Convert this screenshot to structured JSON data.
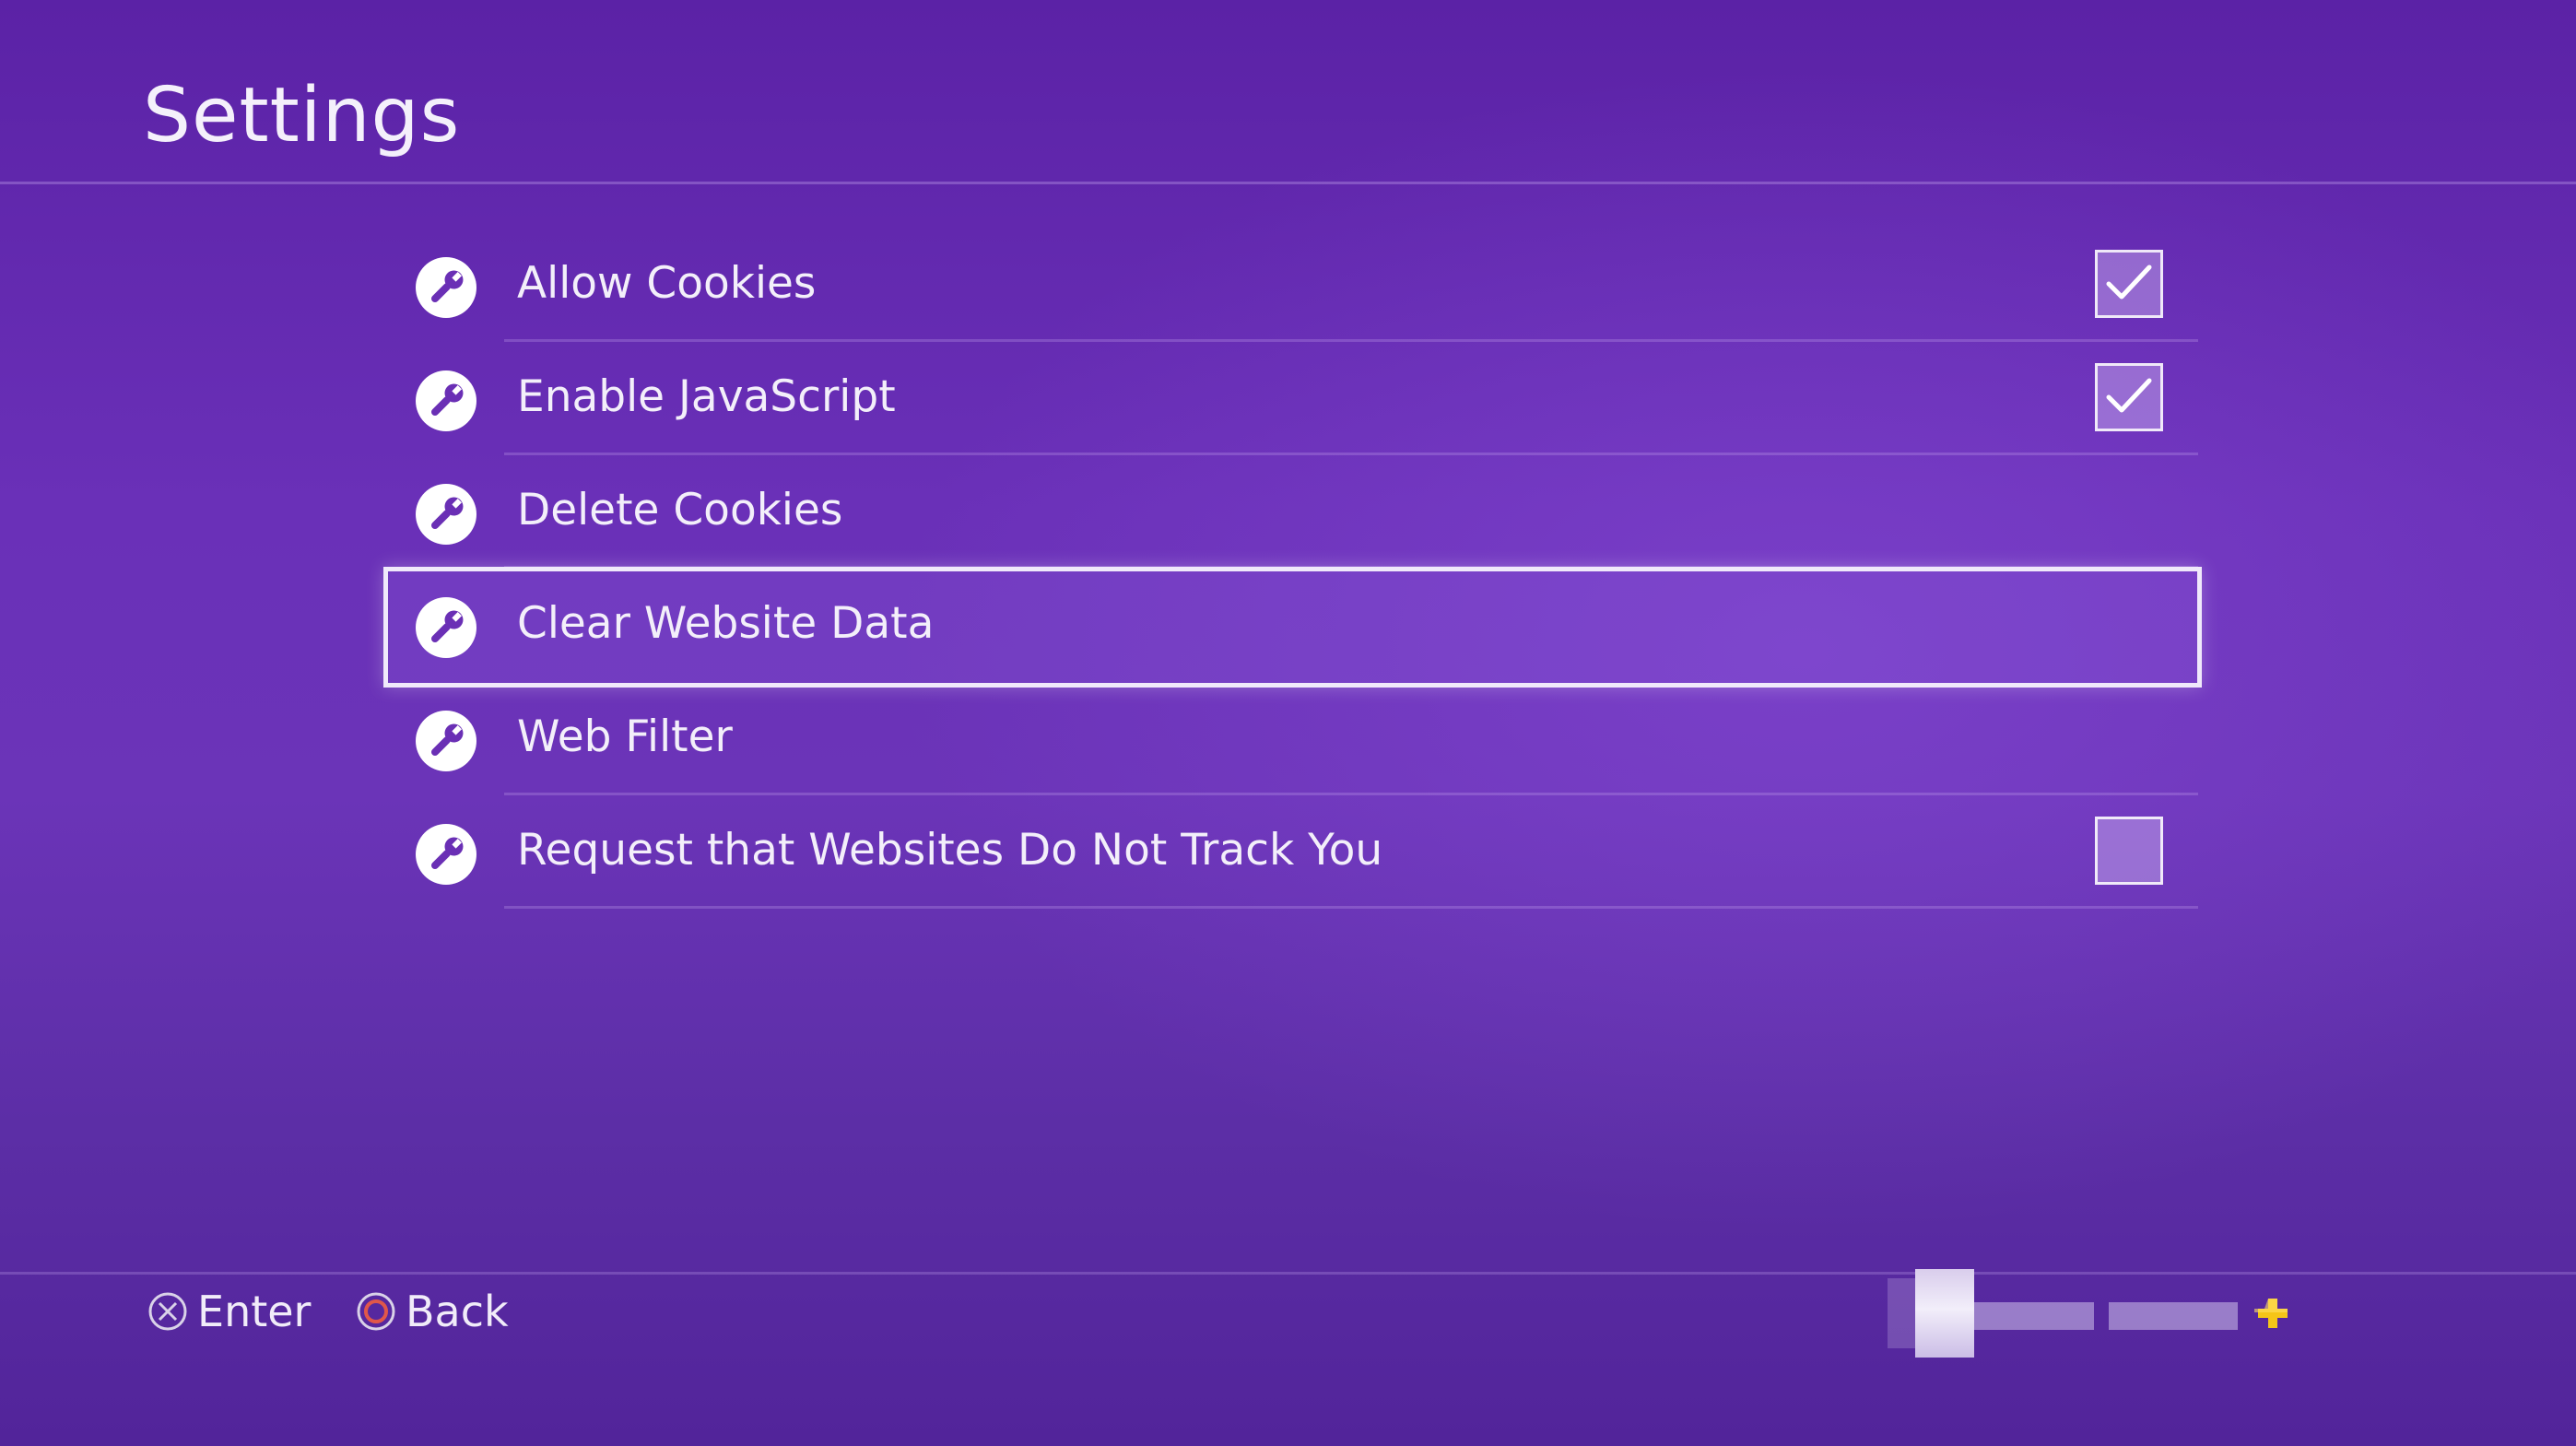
{
  "page": {
    "title": "Settings"
  },
  "menu": {
    "items": [
      {
        "label": "Allow Cookies",
        "icon": "wrench-icon",
        "checkbox": true,
        "checked": true,
        "selected": false
      },
      {
        "label": "Enable JavaScript",
        "icon": "wrench-icon",
        "checkbox": true,
        "checked": true,
        "selected": false
      },
      {
        "label": "Delete Cookies",
        "icon": "wrench-icon",
        "checkbox": false,
        "checked": false,
        "selected": false
      },
      {
        "label": "Clear Website Data",
        "icon": "wrench-icon",
        "checkbox": false,
        "checked": false,
        "selected": true
      },
      {
        "label": "Web Filter",
        "icon": "wrench-icon",
        "checkbox": false,
        "checked": false,
        "selected": false
      },
      {
        "label": "Request that Websites Do Not Track You",
        "icon": "wrench-icon",
        "checkbox": true,
        "checked": false,
        "selected": false
      }
    ]
  },
  "footer": {
    "enter_label": "Enter",
    "enter_icon": "cross-button-icon",
    "back_label": "Back",
    "back_icon": "circle-button-icon",
    "profile_icon": "avatar-icon",
    "plus_icon": "playstation-plus-icon"
  },
  "colors": {
    "background": "#5b22a6",
    "text": "#ffffff",
    "plus": "#f5c518",
    "circle_button": "#e0574a"
  }
}
